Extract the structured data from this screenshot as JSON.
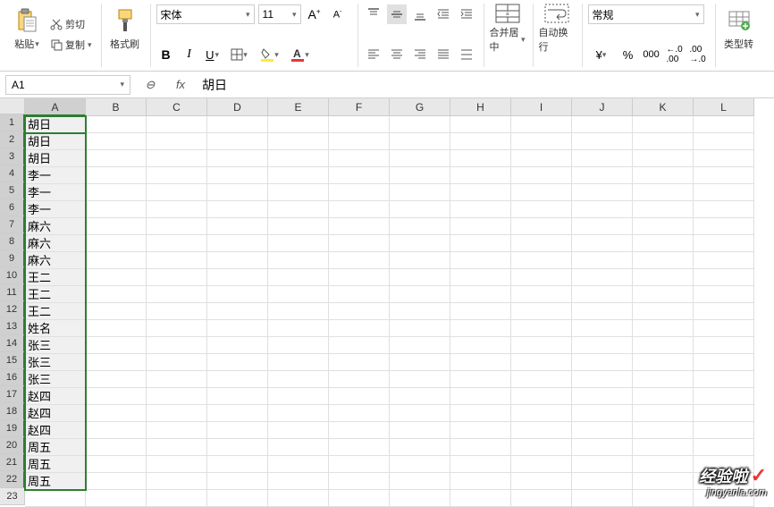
{
  "ribbon": {
    "paste": {
      "label": "粘贴",
      "cut": "剪切",
      "copy": "复制"
    },
    "format_painter": "格式刷",
    "font": {
      "name": "宋体",
      "size": "11"
    },
    "merge": "合并居中",
    "wrap": "自动换行",
    "number_format": "常规",
    "type_conv": "类型转"
  },
  "name_box": "A1",
  "formula": "胡日",
  "columns": [
    "A",
    "B",
    "C",
    "D",
    "E",
    "F",
    "G",
    "H",
    "I",
    "J",
    "K",
    "L"
  ],
  "cells": [
    "胡日",
    "胡日",
    "胡日",
    "李一",
    "李一",
    "李一",
    "麻六",
    "麻六",
    "麻六",
    "王二",
    "王二",
    "王二",
    "姓名",
    "张三",
    "张三",
    "张三",
    "赵四",
    "赵四",
    "赵四",
    "周五",
    "周五",
    "周五"
  ],
  "watermark": {
    "title": "经验啦",
    "url": "jingyanla.com"
  }
}
